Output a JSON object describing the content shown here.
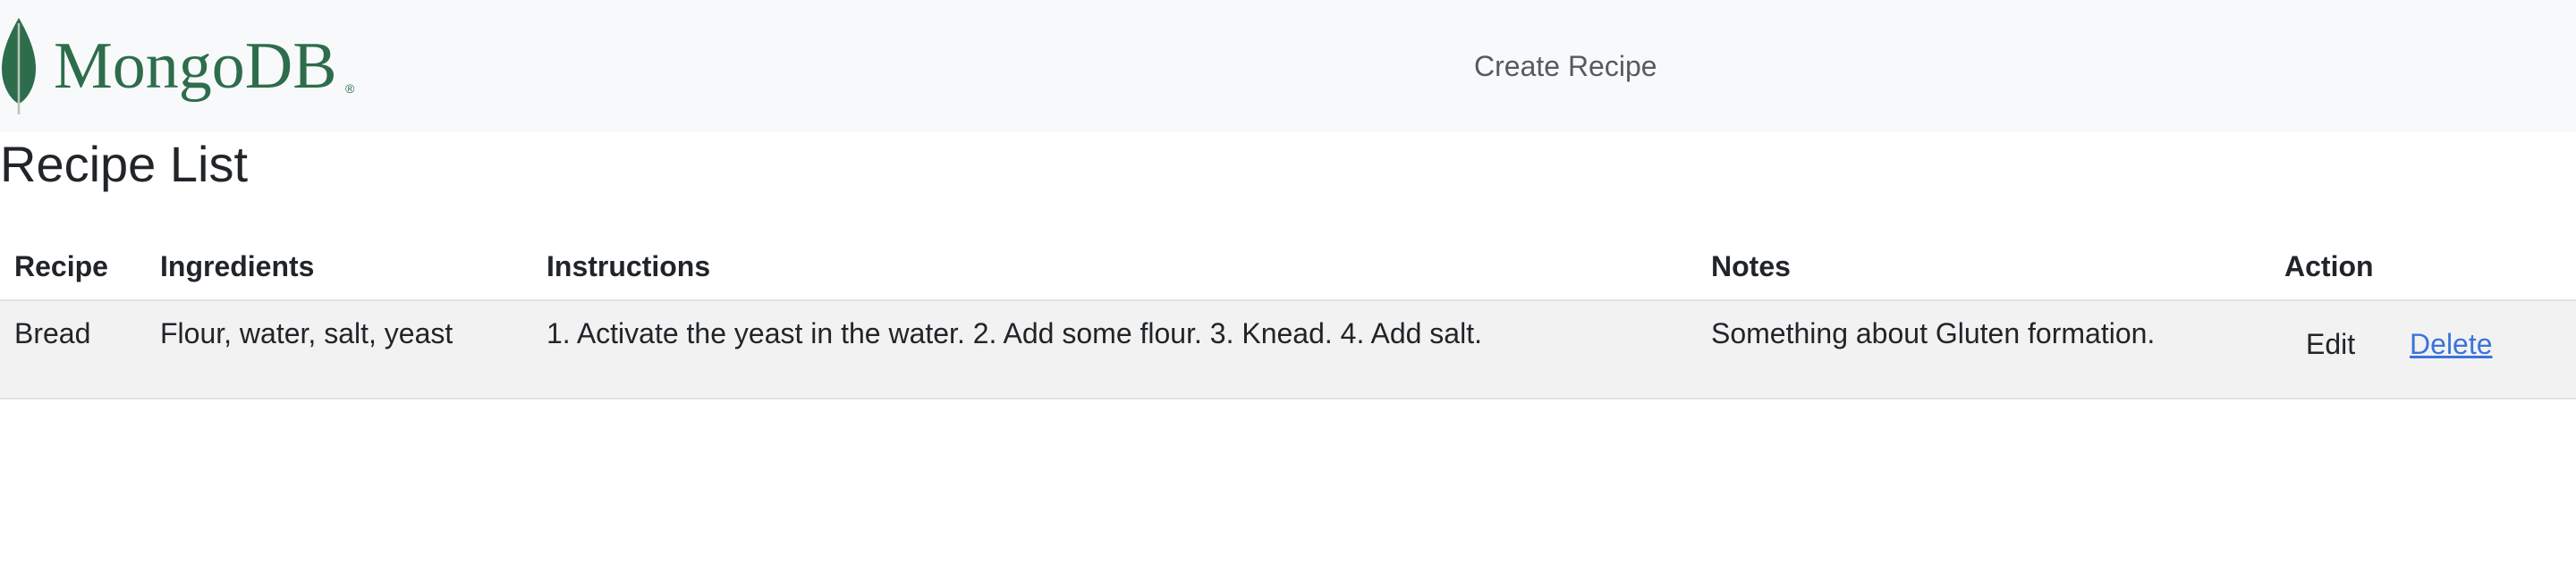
{
  "brand": {
    "logo_text": "MongoDB",
    "registered_mark": "®",
    "logo_icon": "mongodb-leaf-icon",
    "color": "#2d6d4b"
  },
  "nav": {
    "create_link": "Create Recipe"
  },
  "page": {
    "title": "Recipe List"
  },
  "table": {
    "headers": {
      "recipe": "Recipe",
      "ingredients": "Ingredients",
      "instructions": "Instructions",
      "notes": "Notes",
      "action": "Action"
    },
    "rows": [
      {
        "recipe": "Bread",
        "ingredients": "Flour, water, salt, yeast",
        "instructions": "1. Activate the yeast in the water. 2. Add some flour. 3. Knead. 4. Add salt.",
        "notes": "Something about Gluten formation.",
        "edit_label": "Edit",
        "delete_label": "Delete"
      }
    ]
  },
  "colors": {
    "navbar_bg": "#f8f9fa",
    "row_bg": "#f2f2f2",
    "link": "#3b73dc"
  }
}
